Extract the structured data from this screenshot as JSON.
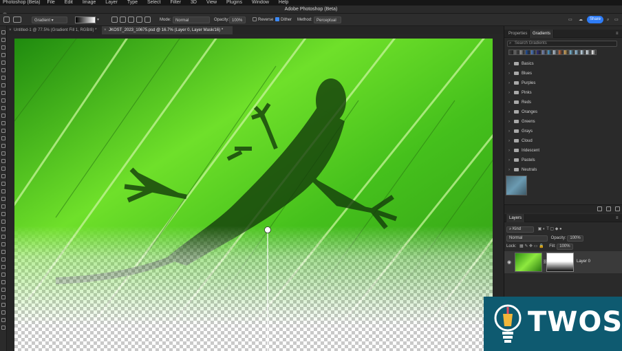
{
  "menubar": {
    "items": [
      "Photoshop (Beta)",
      "File",
      "Edit",
      "Image",
      "Layer",
      "Type",
      "Select",
      "Filter",
      "3D",
      "View",
      "Plugins",
      "Window",
      "Help"
    ]
  },
  "titlebar": {
    "title": "Adobe Photoshop (Beta)"
  },
  "options": {
    "preset": "Gradient",
    "mode_label": "Mode:",
    "mode_value": "Normal",
    "opacity_label": "Opacity:",
    "opacity_value": "100%",
    "reverse_label": "Reverse",
    "reverse_checked": false,
    "dither_label": "Dither",
    "dither_checked": true,
    "method_label": "Method:",
    "method_value": "Perceptual",
    "share_label": "Share"
  },
  "tabs": [
    {
      "label": "Untitled-1 @ 77.5% (Gradient Fill 1, RGB/8) *",
      "active": false
    },
    {
      "label": "JKOST_2023_10675.psd @ 16.7% (Layer 0, Layer Mask/16) *",
      "active": true
    }
  ],
  "panel_tabs": {
    "properties": "Properties",
    "gradients": "Gradients"
  },
  "gradients": {
    "search_placeholder": "Search Gradients",
    "swatch_colors": [
      "#3b3b3b",
      "#6a6a6a",
      "#9c9c9c",
      "#1f4f9c",
      "#4f7fcf",
      "#2f2f7f",
      "#7f8fbf",
      "#4fa0d0",
      "#c0d0e0",
      "#d07040",
      "#e0b060",
      "#80c0e0",
      "#a0d0f0",
      "#d0e8f8",
      "#e8f4fc",
      "#ffffff"
    ],
    "folders": [
      "Basics",
      "Blues",
      "Purples",
      "Pinks",
      "Reds",
      "Oranges",
      "Greens",
      "Grays",
      "Cloud",
      "Iridescent",
      "Pastels",
      "Neutrals"
    ]
  },
  "layers": {
    "tab": "Layers",
    "filter_label": "Kind",
    "blend_mode": "Normal",
    "opacity_label": "Opacity:",
    "opacity_value": "100%",
    "lock_label": "Lock:",
    "fill_label": "Fill:",
    "fill_value": "100%",
    "layer_name": "Layer 0"
  },
  "watermark": {
    "text": "TWOS",
    "color": "#0e5a70"
  }
}
